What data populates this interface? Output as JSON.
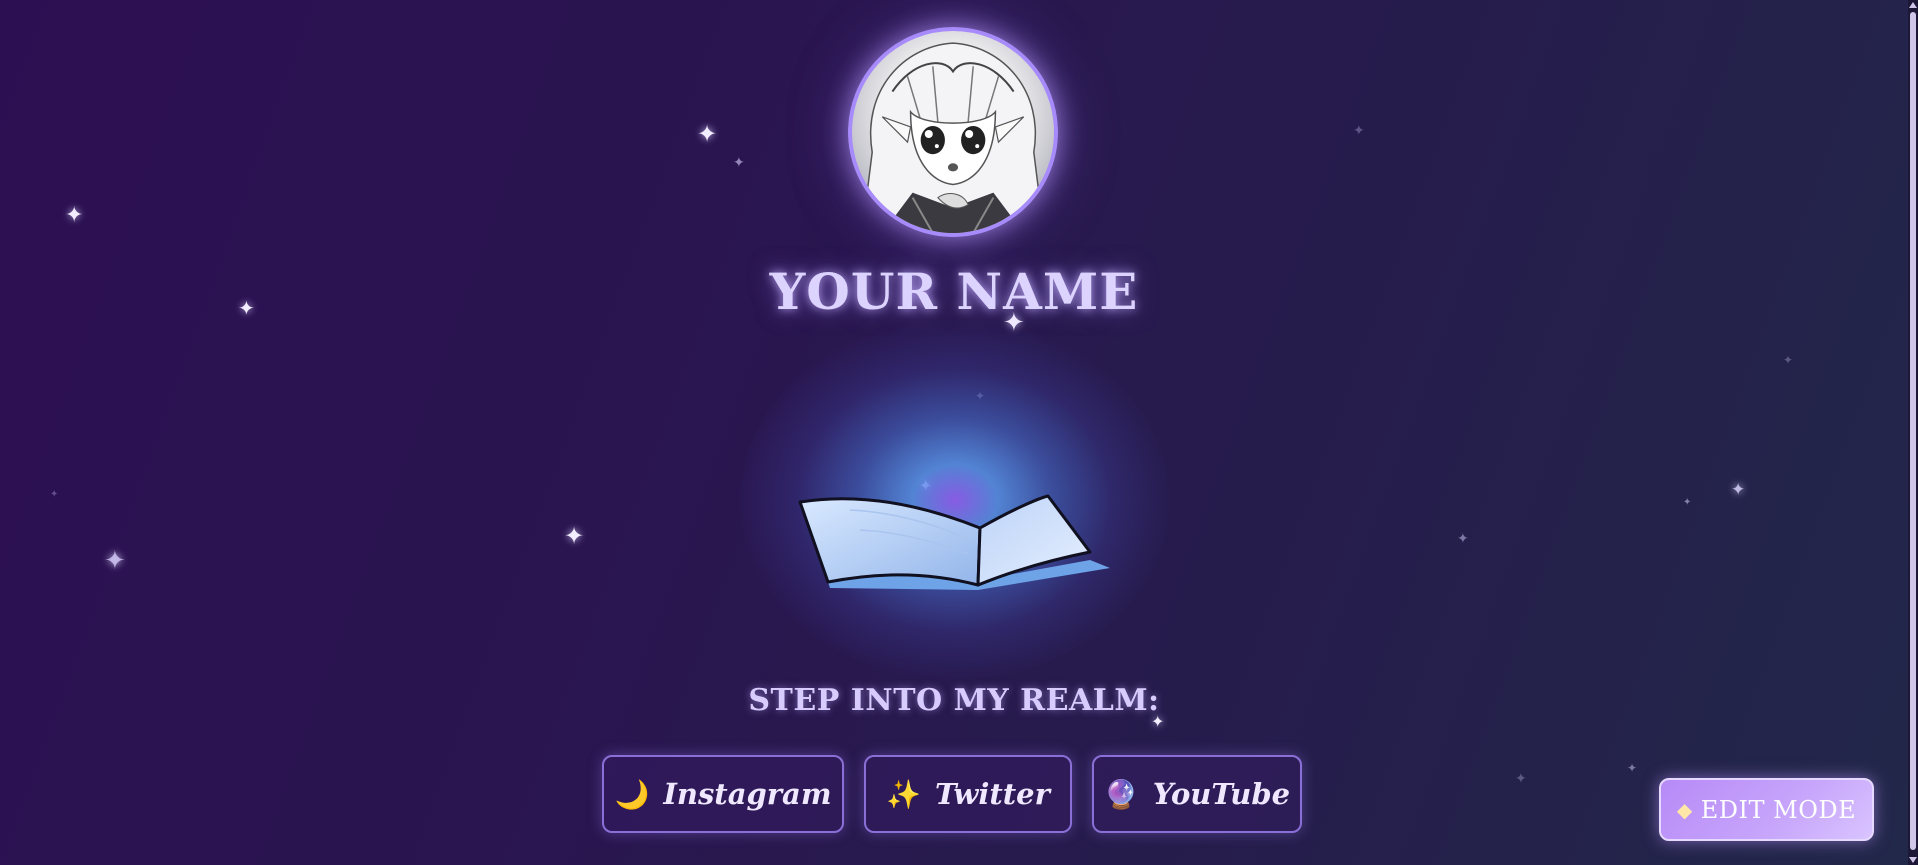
{
  "profile": {
    "name": "YOUR NAME",
    "avatar_icon": "anime-portrait-avatar"
  },
  "hero": {
    "book_icon": "open-book-icon",
    "glow_colors": [
      "#8c5feb",
      "#5a96eb",
      "#4b78dc"
    ]
  },
  "realm": {
    "heading": "STEP INTO MY REALM:"
  },
  "links": [
    {
      "label": "Instagram",
      "icon": "🌙",
      "icon_name": "moon-icon"
    },
    {
      "label": "Twitter",
      "icon": "✨",
      "icon_name": "sparkles-icon"
    },
    {
      "label": "YouTube",
      "icon": "🔮",
      "icon_name": "crystal-ball-icon"
    }
  ],
  "edit": {
    "label": "EDIT MODE",
    "icon": "🔮",
    "icon_name": "crystal-icon"
  },
  "colors": {
    "accent": "#a78bfa",
    "background_start": "#2c0f52",
    "background_end": "#22284a",
    "button_border": "#8a70d6"
  }
}
